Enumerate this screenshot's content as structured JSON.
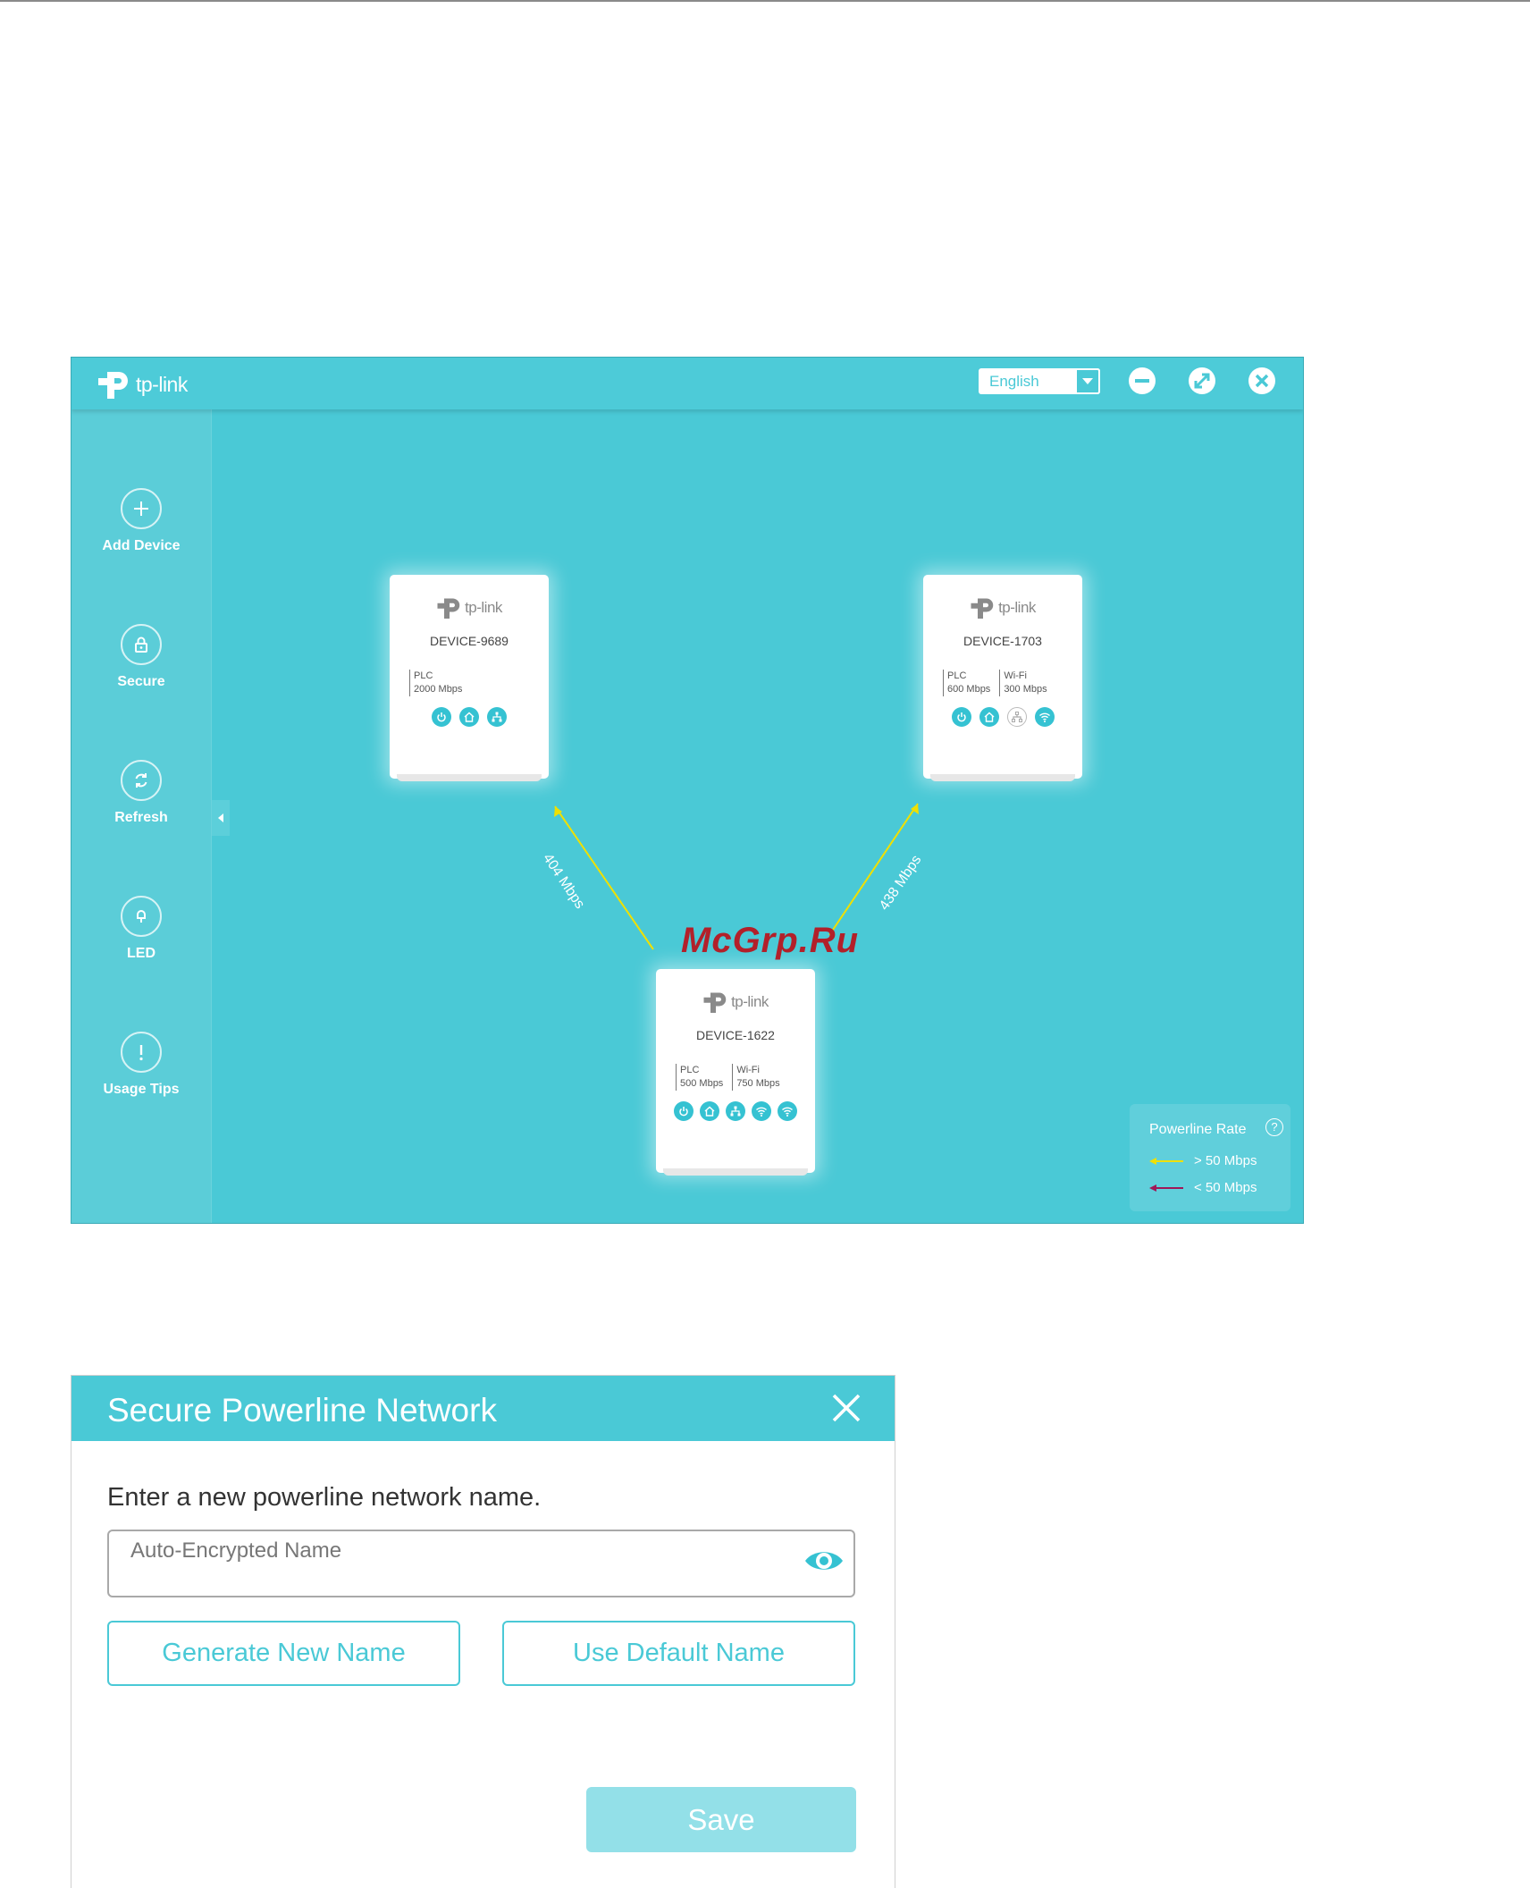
{
  "colors": {
    "accent": "#4ac9d6",
    "link_fast": "#f0e000",
    "link_slow": "#a01858",
    "watermark": "#b2202a"
  },
  "app": {
    "logo_text": "tp-link",
    "language": "English",
    "window_controls": [
      "minimize-icon",
      "restore-icon",
      "close-icon"
    ],
    "sidebar": {
      "items": [
        {
          "label": "Add Device",
          "icon": "plus-icon"
        },
        {
          "label": "Secure",
          "icon": "lock-icon"
        },
        {
          "label": "Refresh",
          "icon": "refresh-icon"
        },
        {
          "label": "LED",
          "icon": "bulb-icon"
        },
        {
          "label": "Usage Tips",
          "icon": "exclamation-icon"
        }
      ]
    },
    "devices": [
      {
        "name": "DEVICE-9689",
        "logo": "tp-link",
        "specs": [
          {
            "label": "PLC",
            "value": "2000 Mbps"
          }
        ],
        "icons": [
          "power-icon",
          "home-icon",
          "ethernet-icon"
        ]
      },
      {
        "name": "DEVICE-1703",
        "logo": "tp-link",
        "specs": [
          {
            "label": "PLC",
            "value": "600 Mbps"
          },
          {
            "label": "Wi-Fi",
            "value": "300 Mbps"
          }
        ],
        "icons": [
          "power-icon",
          "home-icon",
          "ethernet-icon",
          "wifi-icon"
        ]
      },
      {
        "name": "DEVICE-1622",
        "logo": "tp-link",
        "specs": [
          {
            "label": "PLC",
            "value": "500 Mbps"
          },
          {
            "label": "Wi-Fi",
            "value": "750 Mbps"
          }
        ],
        "icons": [
          "power-icon",
          "home-icon",
          "ethernet-icon",
          "wifi-icon",
          "wifi-icon"
        ]
      }
    ],
    "links": [
      {
        "label": "404 Mbps"
      },
      {
        "label": "438 Mbps"
      }
    ],
    "powerline_rate": {
      "title": "Powerline Rate",
      "help": "?",
      "legend": [
        {
          "label": "> 50 Mbps"
        },
        {
          "label": "< 50 Mbps"
        }
      ]
    }
  },
  "watermark": "McGrp.Ru",
  "dialog": {
    "title": "Secure Powerline Network",
    "prompt": "Enter a new powerline network name.",
    "input_placeholder": "Auto-Encrypted Name",
    "generate_label": "Generate New Name",
    "default_label": "Use Default Name",
    "save_label": "Save"
  }
}
